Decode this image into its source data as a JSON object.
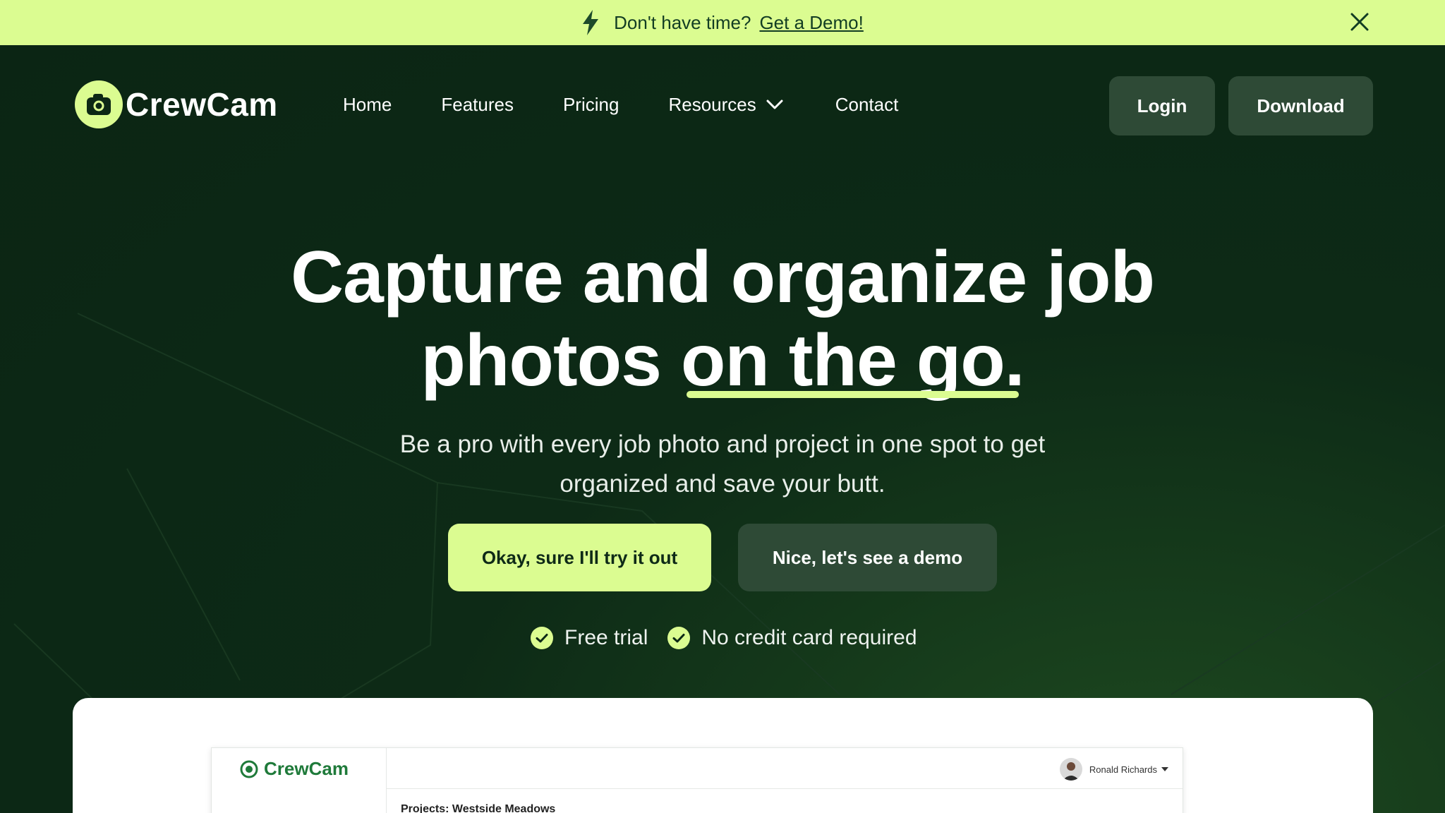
{
  "announcement": {
    "lead_text": "Don't have time?",
    "link_text": "Get a Demo!",
    "icons": [
      "lightning-bolt-icon",
      "close-icon"
    ]
  },
  "nav": {
    "brand": "CrewCam",
    "items": [
      {
        "label": "Home"
      },
      {
        "label": "Features"
      },
      {
        "label": "Pricing"
      },
      {
        "label": "Resources",
        "has_dropdown": true
      },
      {
        "label": "Contact"
      }
    ],
    "login_label": "Login",
    "download_label": "Download"
  },
  "hero": {
    "headline_line1": "Capture and organize job",
    "headline_line2_plain": "photos ",
    "headline_line2_underlined": "on the go.",
    "subtitle": "Be a pro with every job photo and project in one spot to get organized and save your butt.",
    "cta_primary": "Okay, sure I'll try it out",
    "cta_secondary": "Nice, let's see a demo",
    "checks": [
      "Free trial",
      "No credit card required"
    ]
  },
  "preview": {
    "brand": "CrewCam",
    "user_name": "Ronald Richards",
    "project_title": "Projects: Westside Meadows"
  },
  "colors": {
    "accent": "#dbfc91",
    "background": "#0c2815",
    "button_dark": "#2e4a36",
    "text_dark": "#123d23"
  }
}
